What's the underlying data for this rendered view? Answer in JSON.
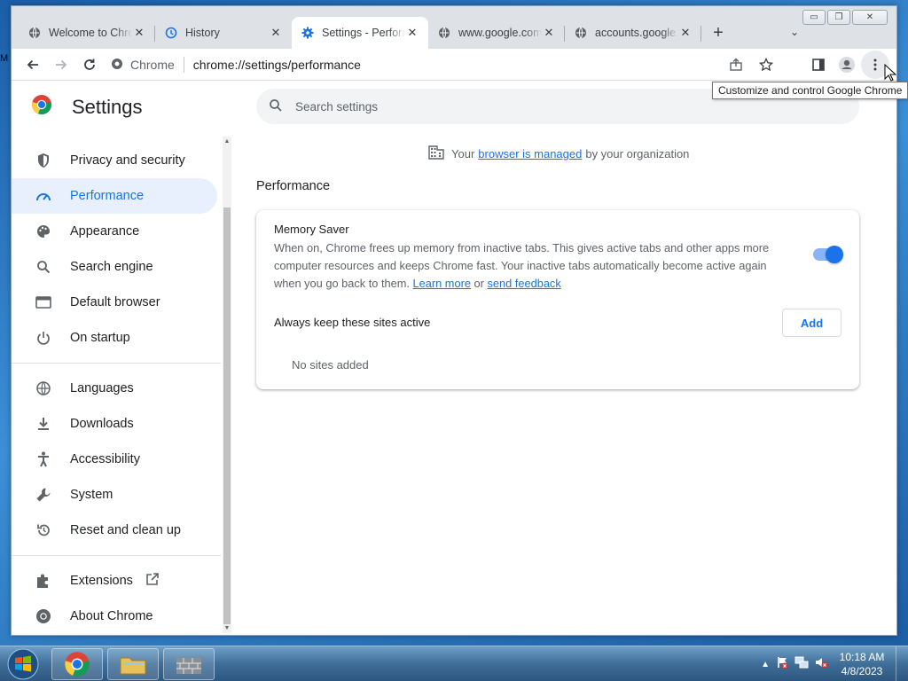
{
  "desktop": {
    "edge_text": "M"
  },
  "window": {
    "controls": {
      "minimize": "▭",
      "maximize": "❐",
      "close": "✕"
    }
  },
  "tabs": [
    {
      "title": "Welcome to Chrome",
      "icon": "globe-icon",
      "close": "✕"
    },
    {
      "title": "History",
      "icon": "history-icon",
      "close": "✕"
    },
    {
      "title": "Settings - Performance",
      "icon": "gear-icon",
      "close": "✕",
      "active": true
    },
    {
      "title": "www.google.com",
      "icon": "globe-icon",
      "close": "✕"
    },
    {
      "title": "accounts.google.com",
      "icon": "globe-icon",
      "close": "✕"
    }
  ],
  "new_tab_label": "+",
  "tab_search_label": "⌄",
  "toolbar": {
    "site_label": "Chrome",
    "url": "chrome://settings/performance"
  },
  "tooltip": "Customize and control Google Chrome",
  "settings": {
    "title": "Settings",
    "search_placeholder": "Search settings",
    "nav": [
      {
        "label": "Privacy and security",
        "icon": "shield-icon"
      },
      {
        "label": "Performance",
        "icon": "speedometer-icon",
        "active": true
      },
      {
        "label": "Appearance",
        "icon": "palette-icon"
      },
      {
        "label": "Search engine",
        "icon": "search-icon"
      },
      {
        "label": "Default browser",
        "icon": "browser-icon"
      },
      {
        "label": "On startup",
        "icon": "power-icon"
      },
      {
        "label": "Languages",
        "icon": "globe-icon"
      },
      {
        "label": "Downloads",
        "icon": "download-icon"
      },
      {
        "label": "Accessibility",
        "icon": "accessibility-icon"
      },
      {
        "label": "System",
        "icon": "wrench-icon"
      },
      {
        "label": "Reset and clean up",
        "icon": "reset-icon"
      },
      {
        "label": "Extensions",
        "icon": "puzzle-icon"
      },
      {
        "label": "About Chrome",
        "icon": "chrome-icon"
      }
    ],
    "managed": {
      "prefix": "Your",
      "link": "browser is managed",
      "suffix": "by your organization"
    },
    "section_title": "Performance",
    "memory_saver": {
      "title": "Memory Saver",
      "desc": "When on, Chrome frees up memory from inactive tabs. This gives active tabs and other apps more computer resources and keeps Chrome fast. Your inactive tabs automatically become active again when you go back to them.",
      "learn_more": "Learn more",
      "or": "or",
      "send_feedback": "send feedback",
      "enabled": true
    },
    "always_active": {
      "label": "Always keep these sites active",
      "add_button": "Add",
      "empty": "No sites added"
    }
  },
  "taskbar": {
    "time": "10:18 AM",
    "date": "4/8/2023"
  },
  "colors": {
    "accent": "#1a73e8",
    "active_nav_bg": "#e8f0fe"
  }
}
